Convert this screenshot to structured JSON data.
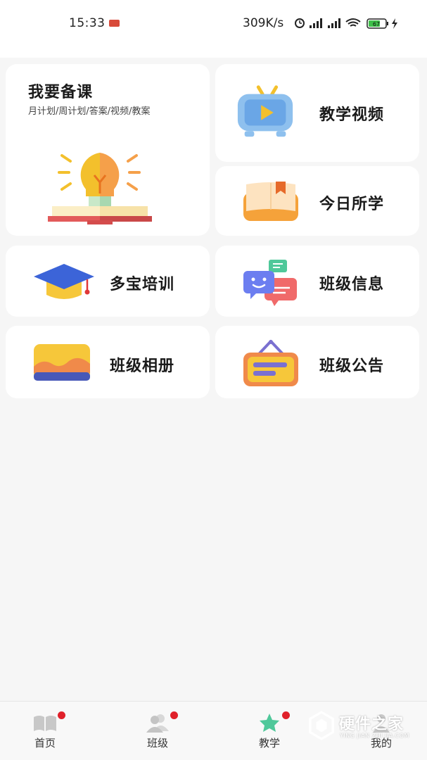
{
  "status_bar": {
    "time": "15:33",
    "network_speed": "309K/s",
    "battery_level": "67",
    "icons": [
      "alarm-icon",
      "signal-icon",
      "signal-icon",
      "wifi-icon",
      "battery-icon",
      "charging-icon"
    ]
  },
  "cards": {
    "prepare": {
      "title": "我要备课",
      "subtitle": "月计划/周计划/答案/视频/教案",
      "icon": "lightbulb-book-icon"
    },
    "teaching_video": {
      "title": "教学视频",
      "icon": "tv-play-icon"
    },
    "today_learning": {
      "title": "今日所学",
      "icon": "bookmark-book-icon"
    },
    "duobao_training": {
      "title": "多宝培训",
      "icon": "graduation-cap-icon"
    },
    "class_info": {
      "title": "班级信息",
      "icon": "chat-bubbles-icon"
    },
    "class_album": {
      "title": "班级相册",
      "icon": "photo-album-icon"
    },
    "class_notice": {
      "title": "班级公告",
      "icon": "notice-board-icon"
    }
  },
  "tabbar": {
    "active": "教学",
    "items": [
      {
        "label": "首页",
        "icon": "book-icon",
        "has_dot": true
      },
      {
        "label": "班级",
        "icon": "users-icon",
        "has_dot": true
      },
      {
        "label": "教学",
        "icon": "star-icon",
        "has_dot": true
      },
      {
        "label": "我的",
        "icon": "user-icon",
        "has_dot": false
      }
    ]
  },
  "watermark": {
    "text": "硬件之家",
    "sub": "YING JIAN ZHI JIA.COM"
  },
  "colors": {
    "active_tab": "#4fc89a",
    "dot": "#e0202a",
    "card_bg": "#ffffff",
    "page_bg": "#f6f6f6"
  }
}
